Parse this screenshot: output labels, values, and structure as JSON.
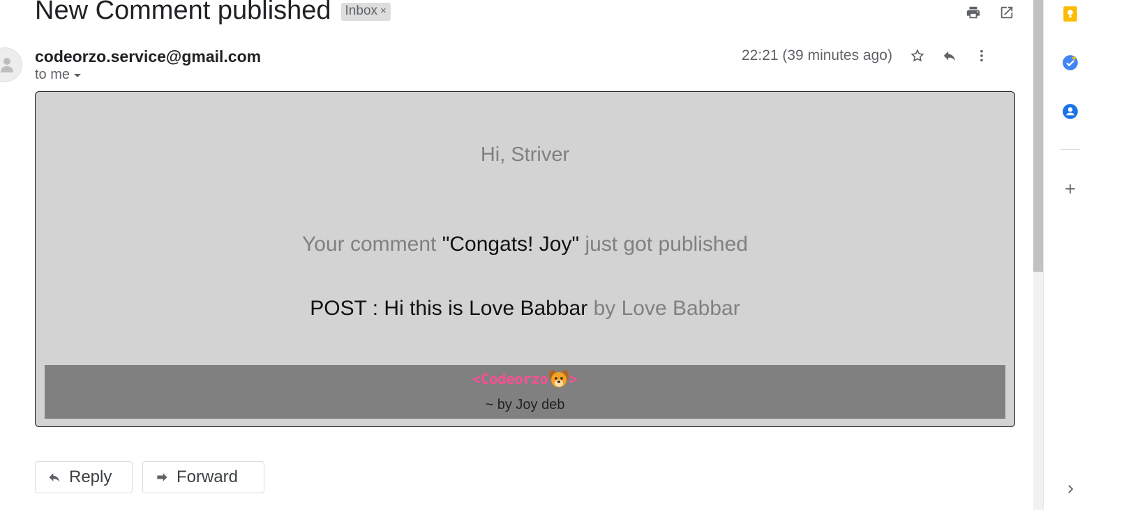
{
  "email": {
    "subject": "New Comment published",
    "label": "Inbox",
    "label_close": "×",
    "sender": "codeorzo.service@gmail.com",
    "recipient": "to me",
    "time": "22:21 (39 minutes ago)"
  },
  "body": {
    "greeting": "Hi, Striver",
    "comment_prefix": "Your comment ",
    "comment_text": "\"Congats! Joy\"",
    "comment_suffix": " just got published",
    "post_label": "POST : Hi this is Love Babbar",
    "post_author": " by Love Babbar",
    "brand_open": "<Codeorzo",
    "brand_close": ">",
    "byline": "~ by Joy deb"
  },
  "actions": {
    "reply": "Reply",
    "forward": "Forward"
  },
  "icons": {
    "print": "print-icon",
    "new_window": "open-in-new-window-icon",
    "star": "star-icon",
    "reply": "reply-icon",
    "more": "more-vert-icon",
    "keep": "keep-icon",
    "tasks": "tasks-icon",
    "contacts": "contacts-icon",
    "add": "add-icon",
    "expand": "chevron-right-icon"
  },
  "colors": {
    "card_bg": "#d3d3d3",
    "footer_bg": "#808080",
    "brand": "#ff4d94",
    "keep": "#fbbc04",
    "tasks": "#4285f4",
    "contacts": "#1a73e8"
  }
}
